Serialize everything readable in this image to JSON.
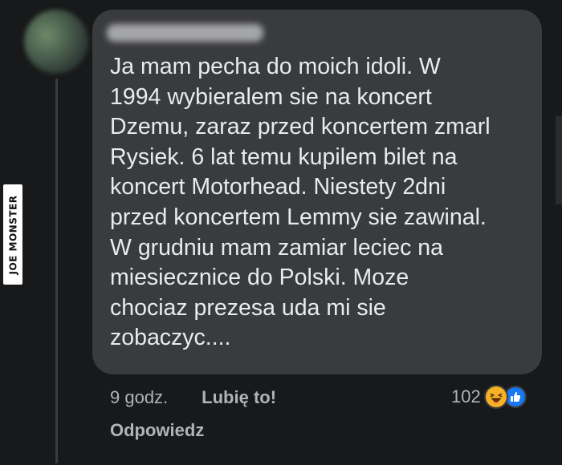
{
  "watermark": {
    "text": "JOE MONSTER"
  },
  "comment": {
    "text": "Ja mam pecha do moich idoli. W\n1994 wybieralem sie na koncert\nDzemu, zaraz przed koncertem zmarl\nRysiek. 6 lat temu kupilem bilet na\nkoncert Motorhead. Niestety 2dni\nprzed koncertem Lemmy sie zawinal.\nW grudniu mam zamiar leciec na\nmiesiecznice do Polski. Moze\nchociaz prezesa uda mi sie\nzobaczyc....",
    "time": "9 godz.",
    "like_label": "Lubię to!",
    "reply_label": "Odpowiedz",
    "reaction_count": "102"
  },
  "reactions": {
    "icons": [
      "haha-icon",
      "like-icon"
    ]
  },
  "colors": {
    "background": "#18191a",
    "bubble": "#3a3b3c",
    "text": "#e9ebee",
    "secondary": "#b0b3b8",
    "haha": "#f7b125",
    "like": "#1877f2"
  }
}
